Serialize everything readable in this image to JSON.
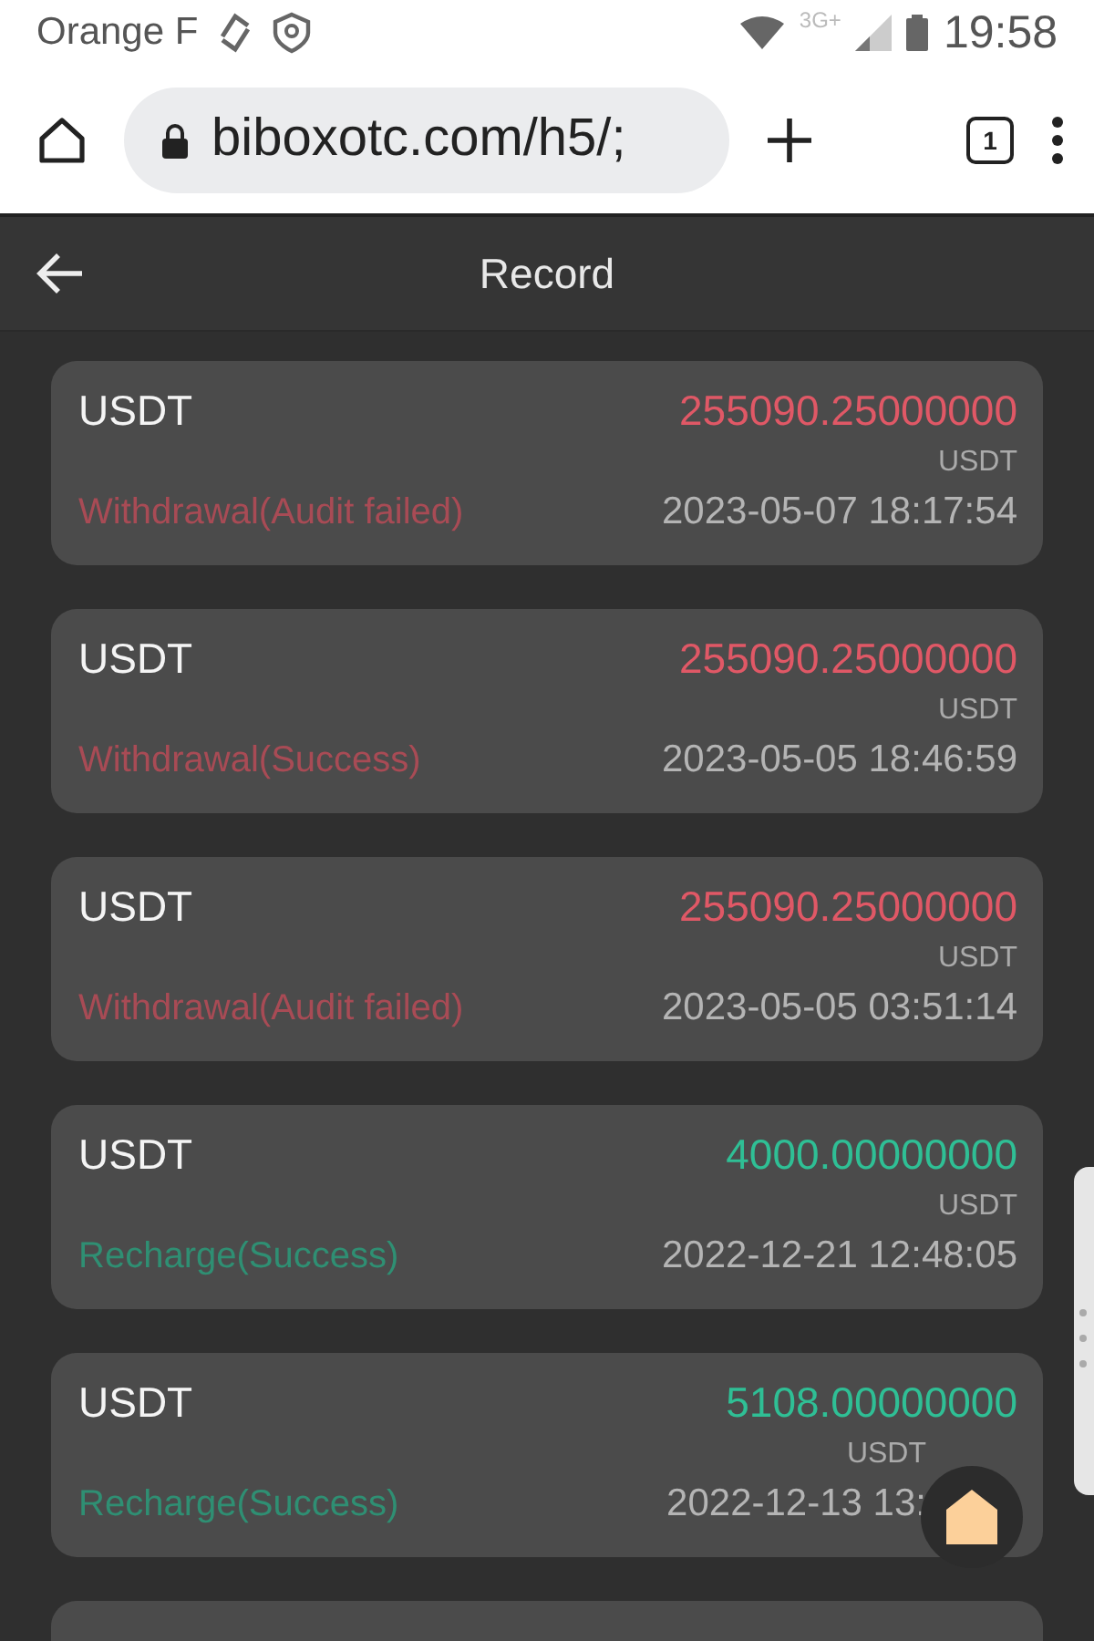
{
  "status_bar": {
    "carrier": "Orange F",
    "network": "3G+",
    "time": "19:58"
  },
  "browser": {
    "url": "biboxotc.com/h5/;",
    "tab_count": "1"
  },
  "header": {
    "title": "Record"
  },
  "records": [
    {
      "kind": "withdrawal",
      "coin": "USDT",
      "amount": "255090.25000000",
      "unit": "USDT",
      "status": "Withdrawal(Audit failed)",
      "time": "2023-05-07 18:17:54"
    },
    {
      "kind": "withdrawal",
      "coin": "USDT",
      "amount": "255090.25000000",
      "unit": "USDT",
      "status": "Withdrawal(Success)",
      "time": "2023-05-05 18:46:59"
    },
    {
      "kind": "withdrawal",
      "coin": "USDT",
      "amount": "255090.25000000",
      "unit": "USDT",
      "status": "Withdrawal(Audit failed)",
      "time": "2023-05-05 03:51:14"
    },
    {
      "kind": "recharge",
      "coin": "USDT",
      "amount": "4000.00000000",
      "unit": "USDT",
      "status": "Recharge(Success)",
      "time": "2022-12-21 12:48:05"
    },
    {
      "kind": "recharge",
      "coin": "USDT",
      "amount": "5108.00000000",
      "unit": "USDT",
      "status": "Recharge(Success)",
      "time": "2022-12-13 13:"
    }
  ]
}
